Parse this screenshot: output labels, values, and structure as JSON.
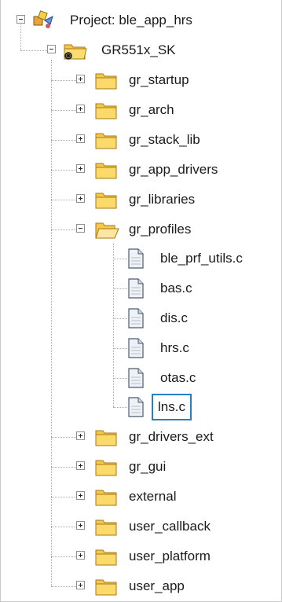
{
  "project": {
    "label": "Project: ble_app_hrs"
  },
  "target": {
    "label": "GR551x_SK"
  },
  "groups_before": [
    {
      "label": "gr_startup"
    },
    {
      "label": "gr_arch"
    },
    {
      "label": "gr_stack_lib"
    },
    {
      "label": "gr_app_drivers"
    },
    {
      "label": "gr_libraries"
    }
  ],
  "open_group": {
    "label": "gr_profiles",
    "files": [
      {
        "label": "ble_prf_utils.c"
      },
      {
        "label": "bas.c"
      },
      {
        "label": "dis.c"
      },
      {
        "label": "hrs.c"
      },
      {
        "label": "otas.c"
      },
      {
        "label": "lns.c"
      }
    ]
  },
  "groups_after": [
    {
      "label": "gr_drivers_ext"
    },
    {
      "label": "gr_gui"
    },
    {
      "label": "external"
    },
    {
      "label": "user_callback"
    },
    {
      "label": "user_platform"
    },
    {
      "label": "user_app"
    }
  ],
  "colors": {
    "selection_border": "#2a7fbf",
    "folder": "#f5c84c"
  }
}
